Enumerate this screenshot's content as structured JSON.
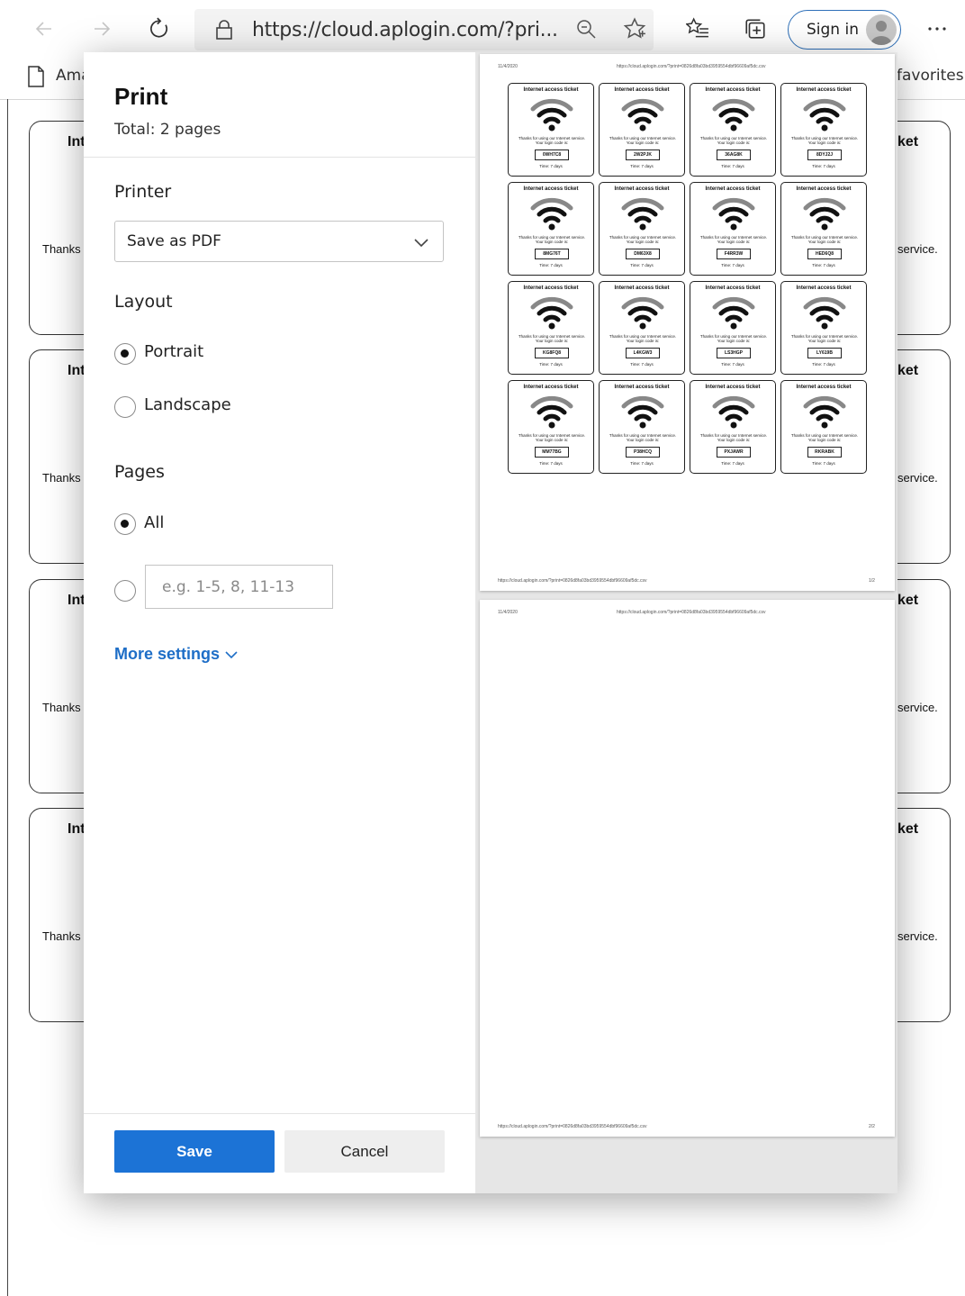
{
  "browser": {
    "url_main": "https://cloud.aplogin.com/",
    "url_rest": "?pri...",
    "sign_in": "Sign in",
    "favorites_left": "Ama",
    "favorites_right": "favorites",
    "icons": [
      "back-icon",
      "forward-icon",
      "refresh-icon",
      "lock-icon",
      "zoom-icon",
      "favorite-star-icon",
      "favorites-list-icon",
      "collections-icon",
      "more-icon"
    ]
  },
  "background_cards": {
    "title_left": "Int",
    "title_right": "ket",
    "text_left": "Thanks",
    "text_right": "service."
  },
  "print": {
    "title": "Print",
    "total": "Total: 2 pages",
    "printer_label": "Printer",
    "printer_value": "Save as PDF",
    "layout_label": "Layout",
    "layout_options": [
      "Portrait",
      "Landscape"
    ],
    "layout_selected": "Portrait",
    "pages_label": "Pages",
    "pages_all": "All",
    "pages_placeholder": "e.g. 1-5, 8, 11-13",
    "more_settings": "More settings",
    "save": "Save",
    "cancel": "Cancel"
  },
  "preview": {
    "date": "11/4/2020",
    "header_url": "https://cloud.aplogin.com/?print=0826d8fa03bd3959554dbf96609af5dc.csv",
    "page1_num": "1/2",
    "page2_num": "2/2",
    "ticket_title": "Internet access ticket",
    "ticket_message": "Thanks for using our Internet service. Your login code is:",
    "ticket_time": "Time: 7 days",
    "codes": [
      "0WH7C8",
      "2W2PJK",
      "36AG8K",
      "8DYJ2J",
      "8MG76T",
      "DM63X8",
      "F4RR3W",
      "HED6Q8",
      "KG8FQ8",
      "L4KGW3",
      "LS3HGP",
      "LY619B",
      "MM77BG",
      "P38HCQ",
      "PXJAWR",
      "RKRABK"
    ]
  }
}
